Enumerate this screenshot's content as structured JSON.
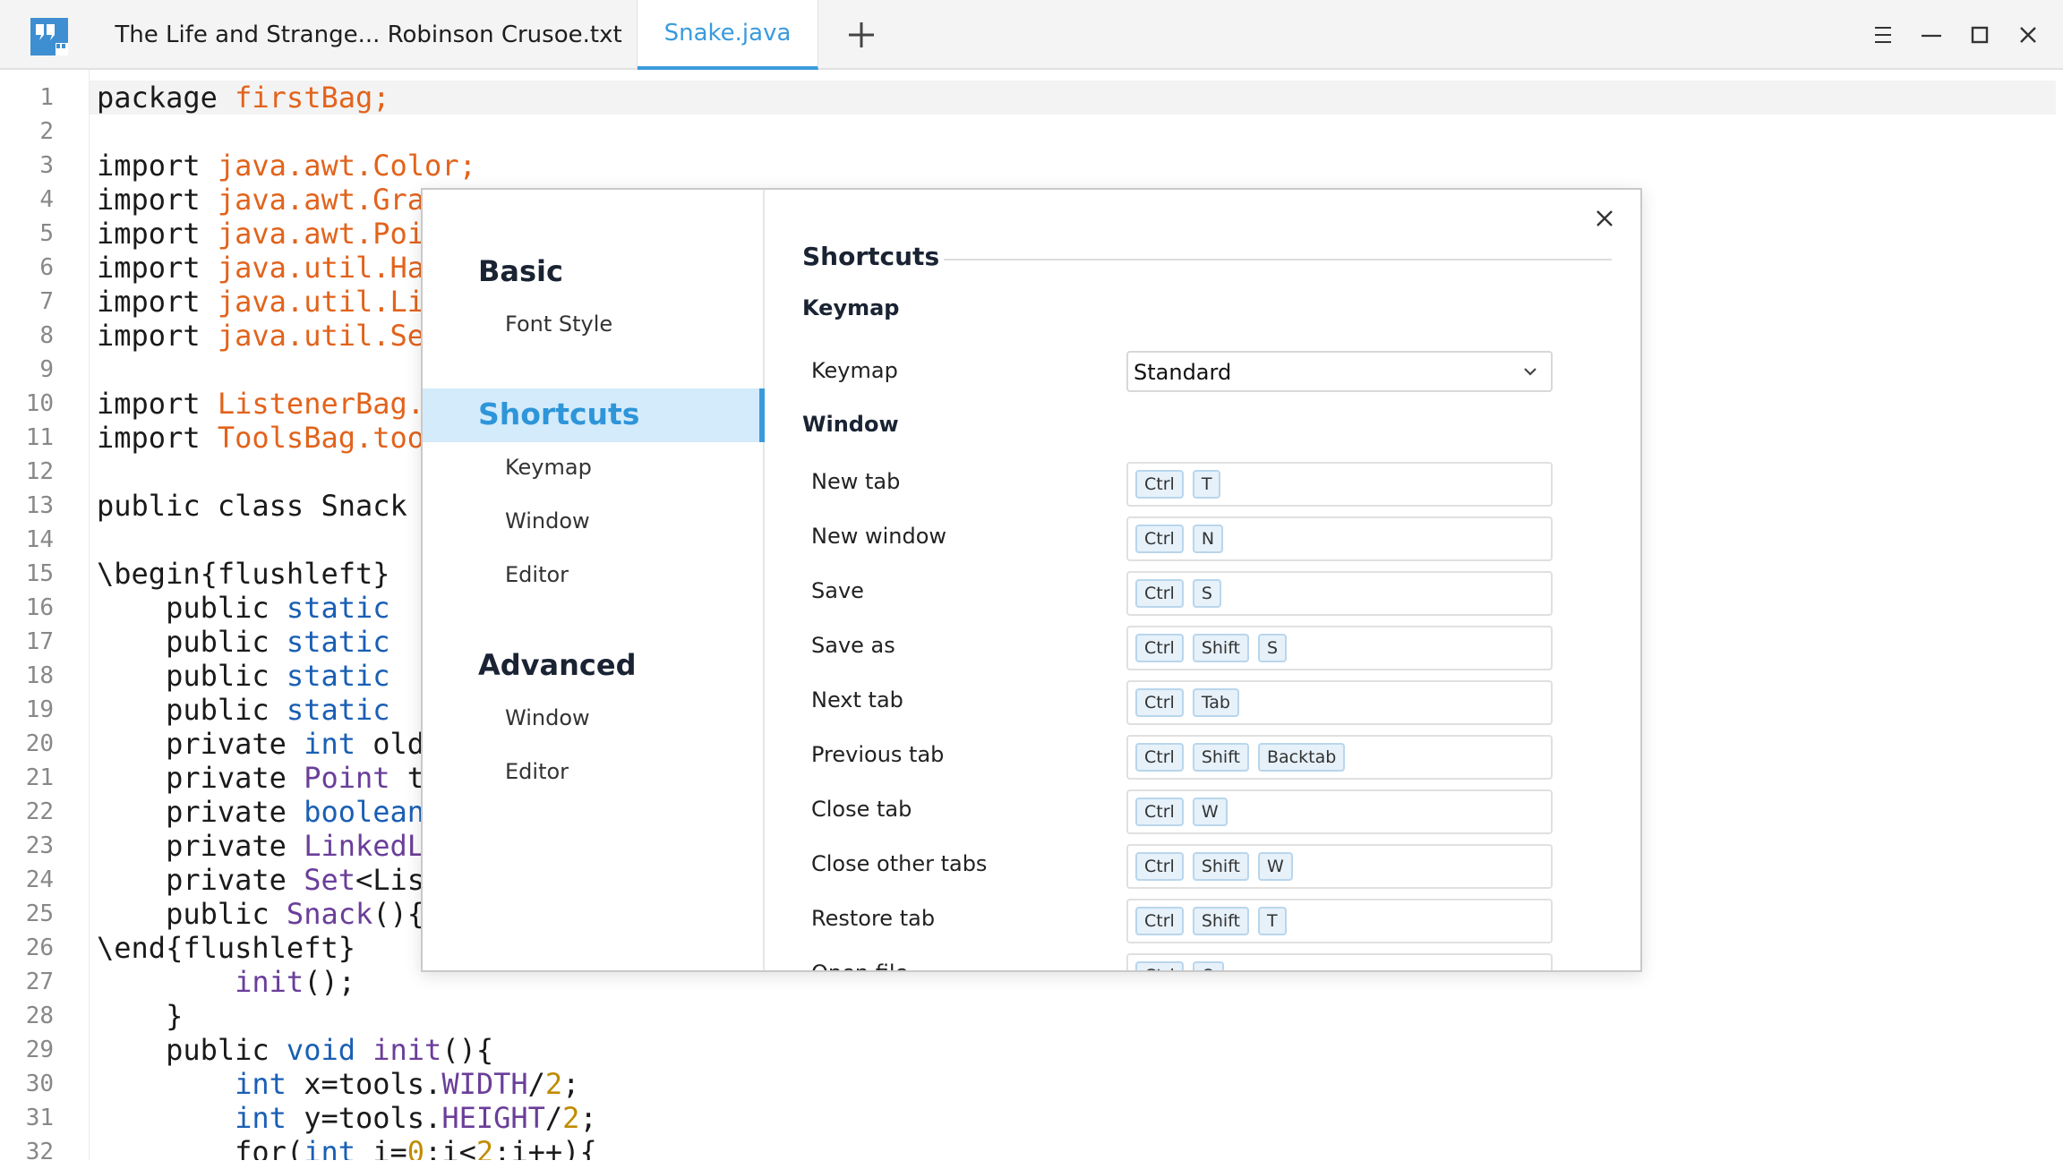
{
  "tabs": [
    {
      "label": "The Life and Strange... Robinson Crusoe.txt",
      "active": false
    },
    {
      "label": "Snake.java",
      "active": true
    }
  ],
  "icons": {
    "logo": "quote-logo-icon",
    "add": "plus-icon",
    "menu": "hamburger-menu-icon",
    "minimize": "minimize-icon",
    "maximize": "maximize-icon",
    "close": "close-icon"
  },
  "colors": {
    "accent": "#3a9bdc",
    "string": "#e2631c",
    "keyword_blue": "#1a5fb4",
    "type_purple": "#6a3e99",
    "number_gold": "#c08b00"
  },
  "editor": {
    "line_numbers": [
      "1",
      "2",
      "3",
      "4",
      "5",
      "6",
      "7",
      "8",
      "9",
      "10",
      "11",
      "12",
      "13",
      "14",
      "15",
      "16",
      "17",
      "18",
      "19",
      "20",
      "21",
      "22",
      "23",
      "24",
      "25",
      "26",
      "27",
      "28",
      "29",
      "30",
      "31",
      "32"
    ],
    "lines": [
      [
        {
          "t": "package ",
          "c": "kw"
        },
        {
          "t": "firstBag;",
          "c": "or"
        }
      ],
      [],
      [
        {
          "t": "import ",
          "c": "kw"
        },
        {
          "t": "java.awt.Color;",
          "c": "or"
        }
      ],
      [
        {
          "t": "import ",
          "c": "kw"
        },
        {
          "t": "java.awt.Gra",
          "c": "or"
        }
      ],
      [
        {
          "t": "import ",
          "c": "kw"
        },
        {
          "t": "java.awt.Poi",
          "c": "or"
        }
      ],
      [
        {
          "t": "import ",
          "c": "kw"
        },
        {
          "t": "java.util.Ha",
          "c": "or"
        }
      ],
      [
        {
          "t": "import ",
          "c": "kw"
        },
        {
          "t": "java.util.Li",
          "c": "or"
        }
      ],
      [
        {
          "t": "import ",
          "c": "kw"
        },
        {
          "t": "java.util.Se",
          "c": "or"
        }
      ],
      [],
      [
        {
          "t": "import ",
          "c": "kw"
        },
        {
          "t": "ListenerBag.",
          "c": "or"
        }
      ],
      [
        {
          "t": "import ",
          "c": "kw"
        },
        {
          "t": "ToolsBag.too",
          "c": "or"
        }
      ],
      [],
      [
        {
          "t": "public class Snack",
          "c": "kw"
        }
      ],
      [],
      [
        {
          "t": "\\begin{flushleft}",
          "c": "kw"
        }
      ],
      [
        {
          "t": "    public ",
          "c": "kw"
        },
        {
          "t": "static",
          "c": "bl"
        }
      ],
      [
        {
          "t": "    public ",
          "c": "kw"
        },
        {
          "t": "static",
          "c": "bl"
        }
      ],
      [
        {
          "t": "    public ",
          "c": "kw"
        },
        {
          "t": "static",
          "c": "bl"
        }
      ],
      [
        {
          "t": "    public ",
          "c": "kw"
        },
        {
          "t": "static",
          "c": "bl"
        }
      ],
      [
        {
          "t": "    private ",
          "c": "kw"
        },
        {
          "t": "int",
          "c": "bl"
        },
        {
          "t": " old",
          "c": "kw"
        }
      ],
      [
        {
          "t": "    private ",
          "c": "kw"
        },
        {
          "t": "Point",
          "c": "pu"
        },
        {
          "t": " t",
          "c": "kw"
        }
      ],
      [
        {
          "t": "    private ",
          "c": "kw"
        },
        {
          "t": "boolean",
          "c": "bl"
        }
      ],
      [
        {
          "t": "    private ",
          "c": "kw"
        },
        {
          "t": "LinkedL",
          "c": "pu"
        }
      ],
      [
        {
          "t": "    private ",
          "c": "kw"
        },
        {
          "t": "Set",
          "c": "pu"
        },
        {
          "t": "<Lis",
          "c": "kw"
        }
      ],
      [
        {
          "t": "    public ",
          "c": "kw"
        },
        {
          "t": "Snack",
          "c": "pu"
        },
        {
          "t": "(){",
          "c": "kw"
        }
      ],
      [
        {
          "t": "\\end{flushleft}",
          "c": "kw"
        }
      ],
      [
        {
          "t": "        ",
          "c": "kw"
        },
        {
          "t": "init",
          "c": "pu"
        },
        {
          "t": "();",
          "c": "kw"
        }
      ],
      [
        {
          "t": "    }",
          "c": "kw"
        }
      ],
      [
        {
          "t": "    public ",
          "c": "kw"
        },
        {
          "t": "void",
          "c": "bl"
        },
        {
          "t": " ",
          "c": "kw"
        },
        {
          "t": "init",
          "c": "pu"
        },
        {
          "t": "(){",
          "c": "kw"
        }
      ],
      [
        {
          "t": "        ",
          "c": "kw"
        },
        {
          "t": "int",
          "c": "bl"
        },
        {
          "t": " x=tools.",
          "c": "kw"
        },
        {
          "t": "WIDTH",
          "c": "pu"
        },
        {
          "t": "/",
          "c": "kw"
        },
        {
          "t": "2",
          "c": "go"
        },
        {
          "t": ";",
          "c": "kw"
        }
      ],
      [
        {
          "t": "        ",
          "c": "kw"
        },
        {
          "t": "int",
          "c": "bl"
        },
        {
          "t": " y=tools.",
          "c": "kw"
        },
        {
          "t": "HEIGHT",
          "c": "pu"
        },
        {
          "t": "/",
          "c": "kw"
        },
        {
          "t": "2",
          "c": "go"
        },
        {
          "t": ";",
          "c": "kw"
        }
      ],
      [
        {
          "t": "        for(",
          "c": "kw"
        },
        {
          "t": "int",
          "c": "bl"
        },
        {
          "t": " i=",
          "c": "kw"
        },
        {
          "t": "0",
          "c": "go"
        },
        {
          "t": ";i<",
          "c": "kw"
        },
        {
          "t": "2",
          "c": "go"
        },
        {
          "t": ";i++){",
          "c": "kw"
        }
      ]
    ]
  },
  "dialog": {
    "nav": {
      "basic": "Basic",
      "font_style": "Font Style",
      "shortcuts": "Shortcuts",
      "keymap": "Keymap",
      "window": "Window",
      "editor": "Editor",
      "advanced": "Advanced",
      "adv_window": "Window",
      "adv_editor": "Editor"
    },
    "section_title": "Shortcuts",
    "keymap_heading": "Keymap",
    "keymap_label": "Keymap",
    "keymap_value": "Standard",
    "window_heading": "Window",
    "shortcuts": [
      {
        "label": "New tab",
        "keys": [
          "Ctrl",
          "T"
        ]
      },
      {
        "label": "New window",
        "keys": [
          "Ctrl",
          "N"
        ]
      },
      {
        "label": "Save",
        "keys": [
          "Ctrl",
          "S"
        ]
      },
      {
        "label": "Save as",
        "keys": [
          "Ctrl",
          "Shift",
          "S"
        ]
      },
      {
        "label": "Next tab",
        "keys": [
          "Ctrl",
          "Tab"
        ]
      },
      {
        "label": "Previous tab",
        "keys": [
          "Ctrl",
          "Shift",
          "Backtab"
        ]
      },
      {
        "label": "Close tab",
        "keys": [
          "Ctrl",
          "W"
        ]
      },
      {
        "label": "Close other tabs",
        "keys": [
          "Ctrl",
          "Shift",
          "W"
        ]
      },
      {
        "label": "Restore tab",
        "keys": [
          "Ctrl",
          "Shift",
          "T"
        ]
      },
      {
        "label": "Open file",
        "keys": [
          "Ctrl",
          "O"
        ]
      }
    ]
  }
}
